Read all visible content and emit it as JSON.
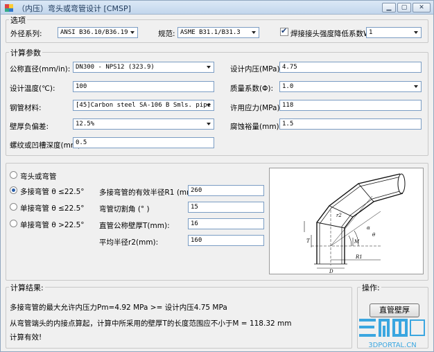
{
  "window": {
    "title": "（内压）弯头或弯管设计 [CMSP]"
  },
  "options": {
    "legend": "选项",
    "outer_diameter_series_label": "外径系列:",
    "outer_diameter_series_value": "ANSI B36.10/B36.19",
    "code_label": "规范:",
    "code_value": "ASME B31.1/B31.3",
    "weld_factor_label": "焊接接头强度降低系数W:",
    "weld_factor_checked": true,
    "weld_factor_value": "1"
  },
  "params": {
    "legend": "计算参数",
    "nominal_diameter_label": "公称直径(mm/in):",
    "nominal_diameter_value": "DN300  - NPS12 (323.9)",
    "design_temp_label": "设计温度(℃):",
    "design_temp_value": "100",
    "pipe_material_label": "钢管材料:",
    "pipe_material_value": "[45]Carbon steel SA-106 B Smls. pipe",
    "wall_tolerance_label": "壁厚负偏差:",
    "wall_tolerance_value": "12.5%",
    "thread_depth_label": "螺纹或凹槽深度(mm):",
    "thread_depth_value": "0.5",
    "design_pressure_label": "设计内压(MPa):",
    "design_pressure_value": "4.75",
    "quality_factor_label": "质量系数(Φ):",
    "quality_factor_value": "1.0",
    "allowable_stress_label": "许用应力(MPa):",
    "allowable_stress_value": "118",
    "corrosion_label": "腐蚀裕量(mm):",
    "corrosion_value": "1.5"
  },
  "bend": {
    "radio_elbow": "弯头或弯管",
    "radio_multi_small": "多接弯管  θ ≤22.5°",
    "radio_single_small": "单接弯管  θ ≤22.5°",
    "radio_single_large": "单接弯管  θ >22.5°",
    "selected": "multi_small",
    "radius_label": "多接弯管的有效半径R1 (mm):",
    "radius_value": "260",
    "cut_angle_label": "弯管切割角 (° )",
    "cut_angle_value": "15",
    "nominal_wall_label": "直管公称壁厚T(mm):",
    "nominal_wall_value": "16",
    "mean_radius_label": "平均半径r2(mm):",
    "mean_radius_value": "160"
  },
  "diagram": {
    "labels": {
      "r1": "R1",
      "d": "D",
      "t": "T",
      "m": "M",
      "alpha": "α",
      "theta": "θ",
      "r2": "r2"
    }
  },
  "results": {
    "legend": "计算结果:",
    "line1": "多接弯管的最大允许内压力Pm=4.92 MPa  >=  设计内压4.75 MPa",
    "line2": "从弯管端头的内接点算起，计算中所采用的壁厚T的长度范围应不小于M = 118.32 mm",
    "line3": "计算有效!"
  },
  "actions": {
    "legend": "操作:",
    "straight_wall_button": "直管壁厚"
  },
  "watermark": {
    "text": "3DPORTAL.CN"
  },
  "colors": {
    "accent": "#2a5ea8",
    "field_border": "#7a9cc3",
    "group_border": "#c8c8c8"
  }
}
